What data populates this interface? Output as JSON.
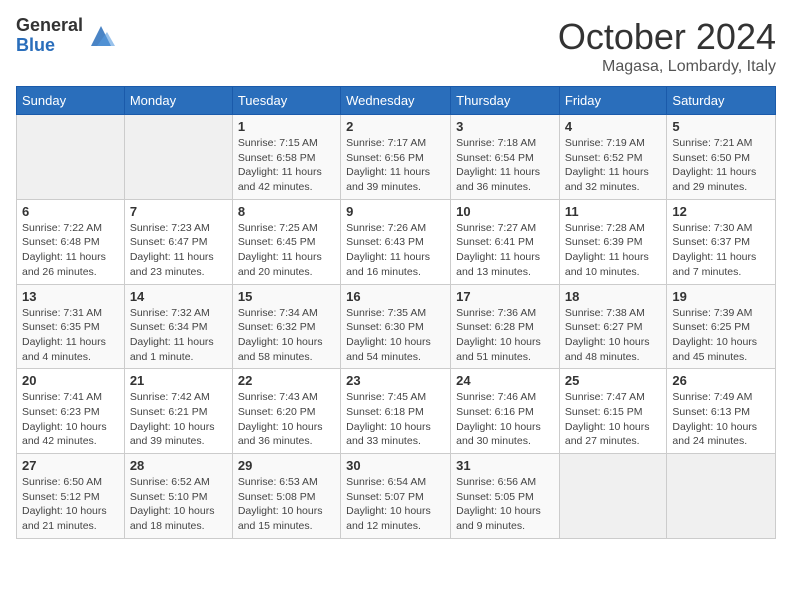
{
  "header": {
    "logo_general": "General",
    "logo_blue": "Blue",
    "month": "October 2024",
    "location": "Magasa, Lombardy, Italy"
  },
  "calendar": {
    "days_of_week": [
      "Sunday",
      "Monday",
      "Tuesday",
      "Wednesday",
      "Thursday",
      "Friday",
      "Saturday"
    ],
    "weeks": [
      [
        {
          "day": null,
          "content": null
        },
        {
          "day": null,
          "content": null
        },
        {
          "day": "1",
          "content": "Sunrise: 7:15 AM\nSunset: 6:58 PM\nDaylight: 11 hours and 42 minutes."
        },
        {
          "day": "2",
          "content": "Sunrise: 7:17 AM\nSunset: 6:56 PM\nDaylight: 11 hours and 39 minutes."
        },
        {
          "day": "3",
          "content": "Sunrise: 7:18 AM\nSunset: 6:54 PM\nDaylight: 11 hours and 36 minutes."
        },
        {
          "day": "4",
          "content": "Sunrise: 7:19 AM\nSunset: 6:52 PM\nDaylight: 11 hours and 32 minutes."
        },
        {
          "day": "5",
          "content": "Sunrise: 7:21 AM\nSunset: 6:50 PM\nDaylight: 11 hours and 29 minutes."
        }
      ],
      [
        {
          "day": "6",
          "content": "Sunrise: 7:22 AM\nSunset: 6:48 PM\nDaylight: 11 hours and 26 minutes."
        },
        {
          "day": "7",
          "content": "Sunrise: 7:23 AM\nSunset: 6:47 PM\nDaylight: 11 hours and 23 minutes."
        },
        {
          "day": "8",
          "content": "Sunrise: 7:25 AM\nSunset: 6:45 PM\nDaylight: 11 hours and 20 minutes."
        },
        {
          "day": "9",
          "content": "Sunrise: 7:26 AM\nSunset: 6:43 PM\nDaylight: 11 hours and 16 minutes."
        },
        {
          "day": "10",
          "content": "Sunrise: 7:27 AM\nSunset: 6:41 PM\nDaylight: 11 hours and 13 minutes."
        },
        {
          "day": "11",
          "content": "Sunrise: 7:28 AM\nSunset: 6:39 PM\nDaylight: 11 hours and 10 minutes."
        },
        {
          "day": "12",
          "content": "Sunrise: 7:30 AM\nSunset: 6:37 PM\nDaylight: 11 hours and 7 minutes."
        }
      ],
      [
        {
          "day": "13",
          "content": "Sunrise: 7:31 AM\nSunset: 6:35 PM\nDaylight: 11 hours and 4 minutes."
        },
        {
          "day": "14",
          "content": "Sunrise: 7:32 AM\nSunset: 6:34 PM\nDaylight: 11 hours and 1 minute."
        },
        {
          "day": "15",
          "content": "Sunrise: 7:34 AM\nSunset: 6:32 PM\nDaylight: 10 hours and 58 minutes."
        },
        {
          "day": "16",
          "content": "Sunrise: 7:35 AM\nSunset: 6:30 PM\nDaylight: 10 hours and 54 minutes."
        },
        {
          "day": "17",
          "content": "Sunrise: 7:36 AM\nSunset: 6:28 PM\nDaylight: 10 hours and 51 minutes."
        },
        {
          "day": "18",
          "content": "Sunrise: 7:38 AM\nSunset: 6:27 PM\nDaylight: 10 hours and 48 minutes."
        },
        {
          "day": "19",
          "content": "Sunrise: 7:39 AM\nSunset: 6:25 PM\nDaylight: 10 hours and 45 minutes."
        }
      ],
      [
        {
          "day": "20",
          "content": "Sunrise: 7:41 AM\nSunset: 6:23 PM\nDaylight: 10 hours and 42 minutes."
        },
        {
          "day": "21",
          "content": "Sunrise: 7:42 AM\nSunset: 6:21 PM\nDaylight: 10 hours and 39 minutes."
        },
        {
          "day": "22",
          "content": "Sunrise: 7:43 AM\nSunset: 6:20 PM\nDaylight: 10 hours and 36 minutes."
        },
        {
          "day": "23",
          "content": "Sunrise: 7:45 AM\nSunset: 6:18 PM\nDaylight: 10 hours and 33 minutes."
        },
        {
          "day": "24",
          "content": "Sunrise: 7:46 AM\nSunset: 6:16 PM\nDaylight: 10 hours and 30 minutes."
        },
        {
          "day": "25",
          "content": "Sunrise: 7:47 AM\nSunset: 6:15 PM\nDaylight: 10 hours and 27 minutes."
        },
        {
          "day": "26",
          "content": "Sunrise: 7:49 AM\nSunset: 6:13 PM\nDaylight: 10 hours and 24 minutes."
        }
      ],
      [
        {
          "day": "27",
          "content": "Sunrise: 6:50 AM\nSunset: 5:12 PM\nDaylight: 10 hours and 21 minutes."
        },
        {
          "day": "28",
          "content": "Sunrise: 6:52 AM\nSunset: 5:10 PM\nDaylight: 10 hours and 18 minutes."
        },
        {
          "day": "29",
          "content": "Sunrise: 6:53 AM\nSunset: 5:08 PM\nDaylight: 10 hours and 15 minutes."
        },
        {
          "day": "30",
          "content": "Sunrise: 6:54 AM\nSunset: 5:07 PM\nDaylight: 10 hours and 12 minutes."
        },
        {
          "day": "31",
          "content": "Sunrise: 6:56 AM\nSunset: 5:05 PM\nDaylight: 10 hours and 9 minutes."
        },
        {
          "day": null,
          "content": null
        },
        {
          "day": null,
          "content": null
        }
      ]
    ]
  }
}
